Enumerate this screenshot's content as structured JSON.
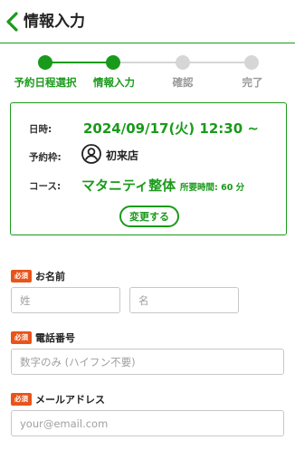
{
  "header": {
    "title": "情報入力",
    "back_icon": "chevron-left-icon"
  },
  "stepper": {
    "steps": [
      {
        "label": "予約日程選択",
        "state": "done"
      },
      {
        "label": "情報入力",
        "state": "current"
      },
      {
        "label": "確認",
        "state": "upcoming"
      },
      {
        "label": "完了",
        "state": "upcoming"
      }
    ]
  },
  "booking": {
    "datetime_label": "日時:",
    "datetime_value": "2024/09/17(火) 12:30 ~",
    "slot_label": "予約枠:",
    "slot_value": "初来店",
    "slot_icon": "person-icon",
    "course_label": "コース:",
    "course_value": "マタニティ整体",
    "duration_text": "所要時間: 60 分",
    "change_button": "変更する"
  },
  "form": {
    "required_badge": "必須",
    "name": {
      "label": "お名前",
      "last_placeholder": "姓",
      "first_placeholder": "名",
      "last_value": "",
      "first_value": ""
    },
    "phone": {
      "label": "電話番号",
      "placeholder": "数字のみ (ハイフン不要)",
      "value": ""
    },
    "email": {
      "label": "メールアドレス",
      "placeholder": "your@email.com",
      "value": ""
    }
  },
  "colors": {
    "accent": "#1a9a1a",
    "inactive": "#d6d6d6",
    "inactive_text": "#9a9a9a",
    "required": "#e8541a",
    "input_border": "#c8c8c8"
  }
}
